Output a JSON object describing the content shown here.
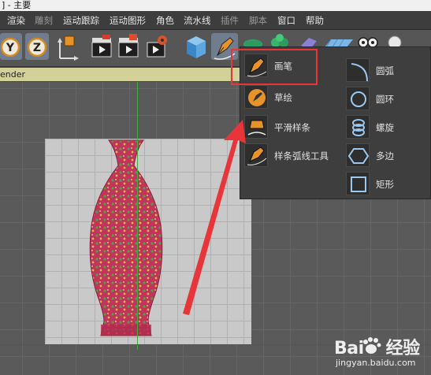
{
  "window": {
    "title": "] - 主要"
  },
  "menubar": {
    "items": [
      {
        "label": "渲染",
        "dim": false
      },
      {
        "label": "雕刻",
        "dim": true
      },
      {
        "label": "运动跟踪",
        "dim": false
      },
      {
        "label": "运动图形",
        "dim": false
      },
      {
        "label": "角色",
        "dim": false
      },
      {
        "label": "流水线",
        "dim": false
      },
      {
        "label": "插件",
        "dim": true
      },
      {
        "label": "脚本",
        "dim": true
      },
      {
        "label": "窗口",
        "dim": false
      },
      {
        "label": "帮助",
        "dim": false
      }
    ]
  },
  "toolbar": {
    "buttons": [
      "Y",
      "Z",
      "coordinate-system",
      "render-view",
      "render-active",
      "render-settings",
      "cube",
      "pen",
      "spline-tools",
      "generators",
      "deformers",
      "scene",
      "camera",
      "light"
    ]
  },
  "viewport": {
    "label": "ender"
  },
  "spline_menu": {
    "left": [
      {
        "label": "画笔",
        "icon": "pen-icon"
      },
      {
        "label": "草绘",
        "icon": "sketch-icon"
      },
      {
        "label": "平滑样条",
        "icon": "smooth-spline-icon"
      },
      {
        "label": "样条弧线工具",
        "icon": "arc-tool-icon"
      }
    ],
    "right": [
      {
        "label": "圆弧",
        "icon": "arc-icon"
      },
      {
        "label": "圆环",
        "icon": "circle-icon"
      },
      {
        "label": "螺旋",
        "icon": "helix-icon"
      },
      {
        "label": "多边",
        "icon": "polygon-icon"
      },
      {
        "label": "矩形",
        "icon": "rectangle-icon"
      }
    ]
  },
  "watermark": {
    "brand": "Bai",
    "du": "度",
    "suffix": "经验",
    "url": "jingyan.baidu.com"
  },
  "colors": {
    "highlight": "#e8353a",
    "axis_y": "#3fae3f",
    "axis_x": "#b03030",
    "vase_base": "#c0365a"
  }
}
